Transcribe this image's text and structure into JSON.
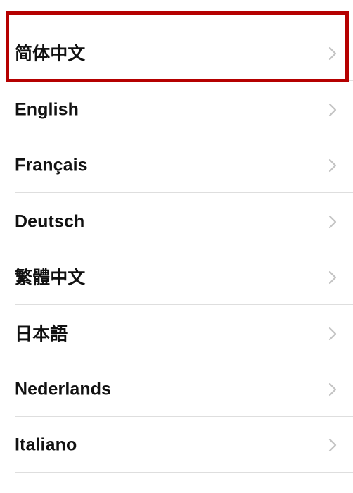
{
  "screen": {
    "background_color": "#FFFFFF",
    "separator_color": "#DEDEDE",
    "text_color": "#111111",
    "chevron_color": "#C3C3C3"
  },
  "annotation": {
    "type": "highlight-box",
    "color": "#B50000",
    "border_width_px": 5,
    "target_item_label": "简体中文",
    "target_item_index": 0
  },
  "language_list": {
    "name": "language-selection-list",
    "items": [
      {
        "label": "简体中文",
        "script": "cjk",
        "chevron": "chevron-right-icon",
        "highlighted": true
      },
      {
        "label": "English",
        "script": "latin",
        "chevron": "chevron-right-icon",
        "highlighted": false
      },
      {
        "label": "Français",
        "script": "latin",
        "chevron": "chevron-right-icon",
        "highlighted": false
      },
      {
        "label": "Deutsch",
        "script": "latin",
        "chevron": "chevron-right-icon",
        "highlighted": false
      },
      {
        "label": "繁體中文",
        "script": "cjk",
        "chevron": "chevron-right-icon",
        "highlighted": false
      },
      {
        "label": "日本語",
        "script": "cjk",
        "chevron": "chevron-right-icon",
        "highlighted": false
      },
      {
        "label": "Nederlands",
        "script": "latin",
        "chevron": "chevron-right-icon",
        "highlighted": false
      },
      {
        "label": "Italiano",
        "script": "latin",
        "chevron": "chevron-right-icon",
        "highlighted": false
      }
    ]
  }
}
